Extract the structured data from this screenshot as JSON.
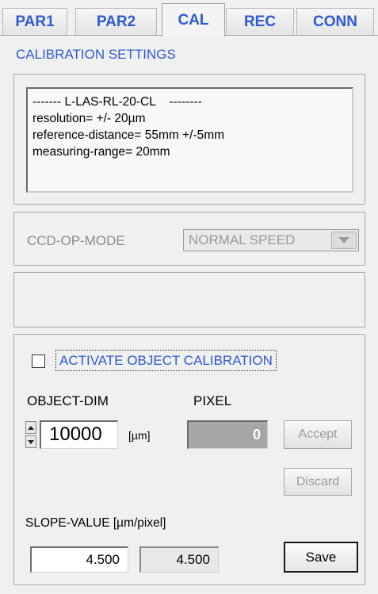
{
  "tabs": [
    {
      "label": "PAR1"
    },
    {
      "label": "PAR2"
    },
    {
      "label": "CAL"
    },
    {
      "label": "REC"
    },
    {
      "label": "CONN"
    }
  ],
  "active_tab": "CAL",
  "section_title": "CALIBRATION SETTINGS",
  "sensor_info": {
    "lines": [
      "------- L-LAS-RL-20-CL    --------",
      "resolution= +/- 20µm",
      "reference-distance= 55mm +/-5mm",
      "measuring-range= 20mm"
    ]
  },
  "ccd_op_mode": {
    "label": "CCD-OP-MODE",
    "value": "NORMAL SPEED"
  },
  "object_calibration": {
    "checkbox_label": "ACTIVATE OBJECT CALIBRATION",
    "checked": false,
    "object_dim_label": "OBJECT-DIM",
    "object_dim_value": "10000",
    "object_dim_unit": "[µm]",
    "pixel_label": "PIXEL",
    "pixel_value": "0",
    "accept_label": "Accept",
    "discard_label": "Discard",
    "slope_label": "SLOPE-VALUE [µm/pixel]",
    "slope_input_value": "4.500",
    "slope_display_value": "4.500",
    "save_label": "Save"
  },
  "colors": {
    "accent": "#2f5bd1",
    "disabled_text": "#9a9a9a",
    "pixel_field_bg": "#a6a6a6"
  }
}
